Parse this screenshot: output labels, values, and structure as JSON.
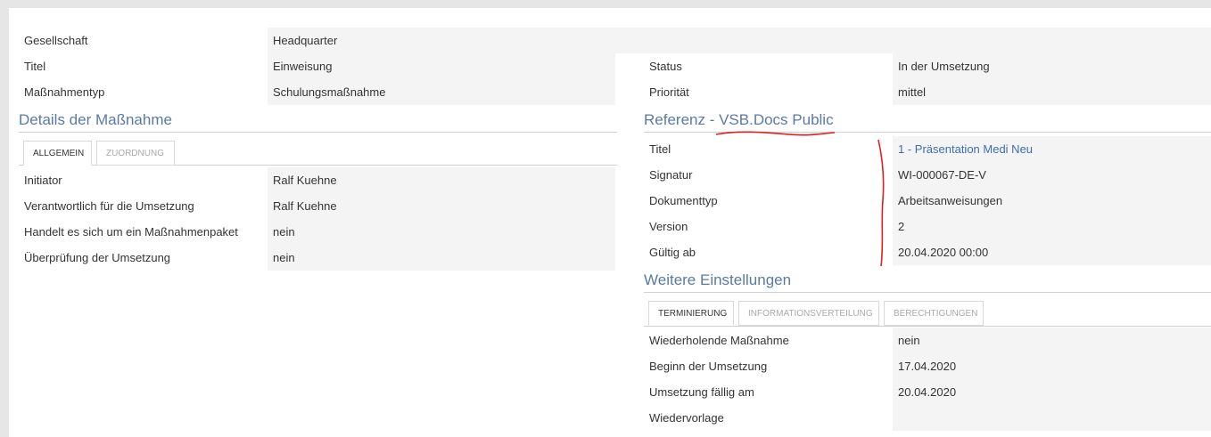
{
  "header": {
    "gesellschaft": {
      "label": "Gesellschaft",
      "value": "Headquarter"
    },
    "titel": {
      "label": "Titel",
      "value": "Einweisung"
    },
    "massnahmentyp": {
      "label": "Maßnahmentyp",
      "value": "Schulungsmaßnahme"
    },
    "status": {
      "label": "Status",
      "value": "In der Umsetzung"
    },
    "prioritaet": {
      "label": "Priorität",
      "value": "mittel"
    }
  },
  "details": {
    "title": "Details der Maßnahme",
    "tabs": [
      {
        "label": "ALLGEMEIN",
        "active": true
      },
      {
        "label": "ZUORDNUNG",
        "active": false
      }
    ],
    "rows": [
      {
        "label": "Initiator",
        "value": "Ralf Kuehne"
      },
      {
        "label": "Verantwortlich für die Umsetzung",
        "value": "Ralf Kuehne"
      },
      {
        "label": "Handelt es sich um ein Maßnahmenpaket",
        "value": "nein"
      },
      {
        "label": "Überprüfung der Umsetzung",
        "value": "nein"
      }
    ]
  },
  "referenz": {
    "title": "Referenz - VSB.Docs Public",
    "rows": [
      {
        "label": "Titel",
        "value": "1 - Präsentation Medi Neu",
        "link": true
      },
      {
        "label": "Signatur",
        "value": "WI-000067-DE-V"
      },
      {
        "label": "Dokumenttyp",
        "value": "Arbeitsanweisungen"
      },
      {
        "label": "Version",
        "value": "2"
      },
      {
        "label": "Gültig ab",
        "value": "20.04.2020 00:00"
      }
    ]
  },
  "weitere": {
    "title": "Weitere Einstellungen",
    "tabs": [
      {
        "label": "TERMINIERUNG",
        "active": true
      },
      {
        "label": "INFORMATIONSVERTEILUNG",
        "active": false
      },
      {
        "label": "BERECHTIGUNGEN",
        "active": false
      }
    ],
    "rows": [
      {
        "label": "Wiederholende Maßnahme",
        "value": "nein"
      },
      {
        "label": "Beginn der Umsetzung",
        "value": "17.04.2020"
      },
      {
        "label": "Umsetzung fällig am",
        "value": "20.04.2020"
      },
      {
        "label": "Wiedervorlage",
        "value": ""
      }
    ]
  },
  "colors": {
    "accent": "#5a7aa6",
    "link": "#3d6db5",
    "annotation": "#e02020"
  }
}
